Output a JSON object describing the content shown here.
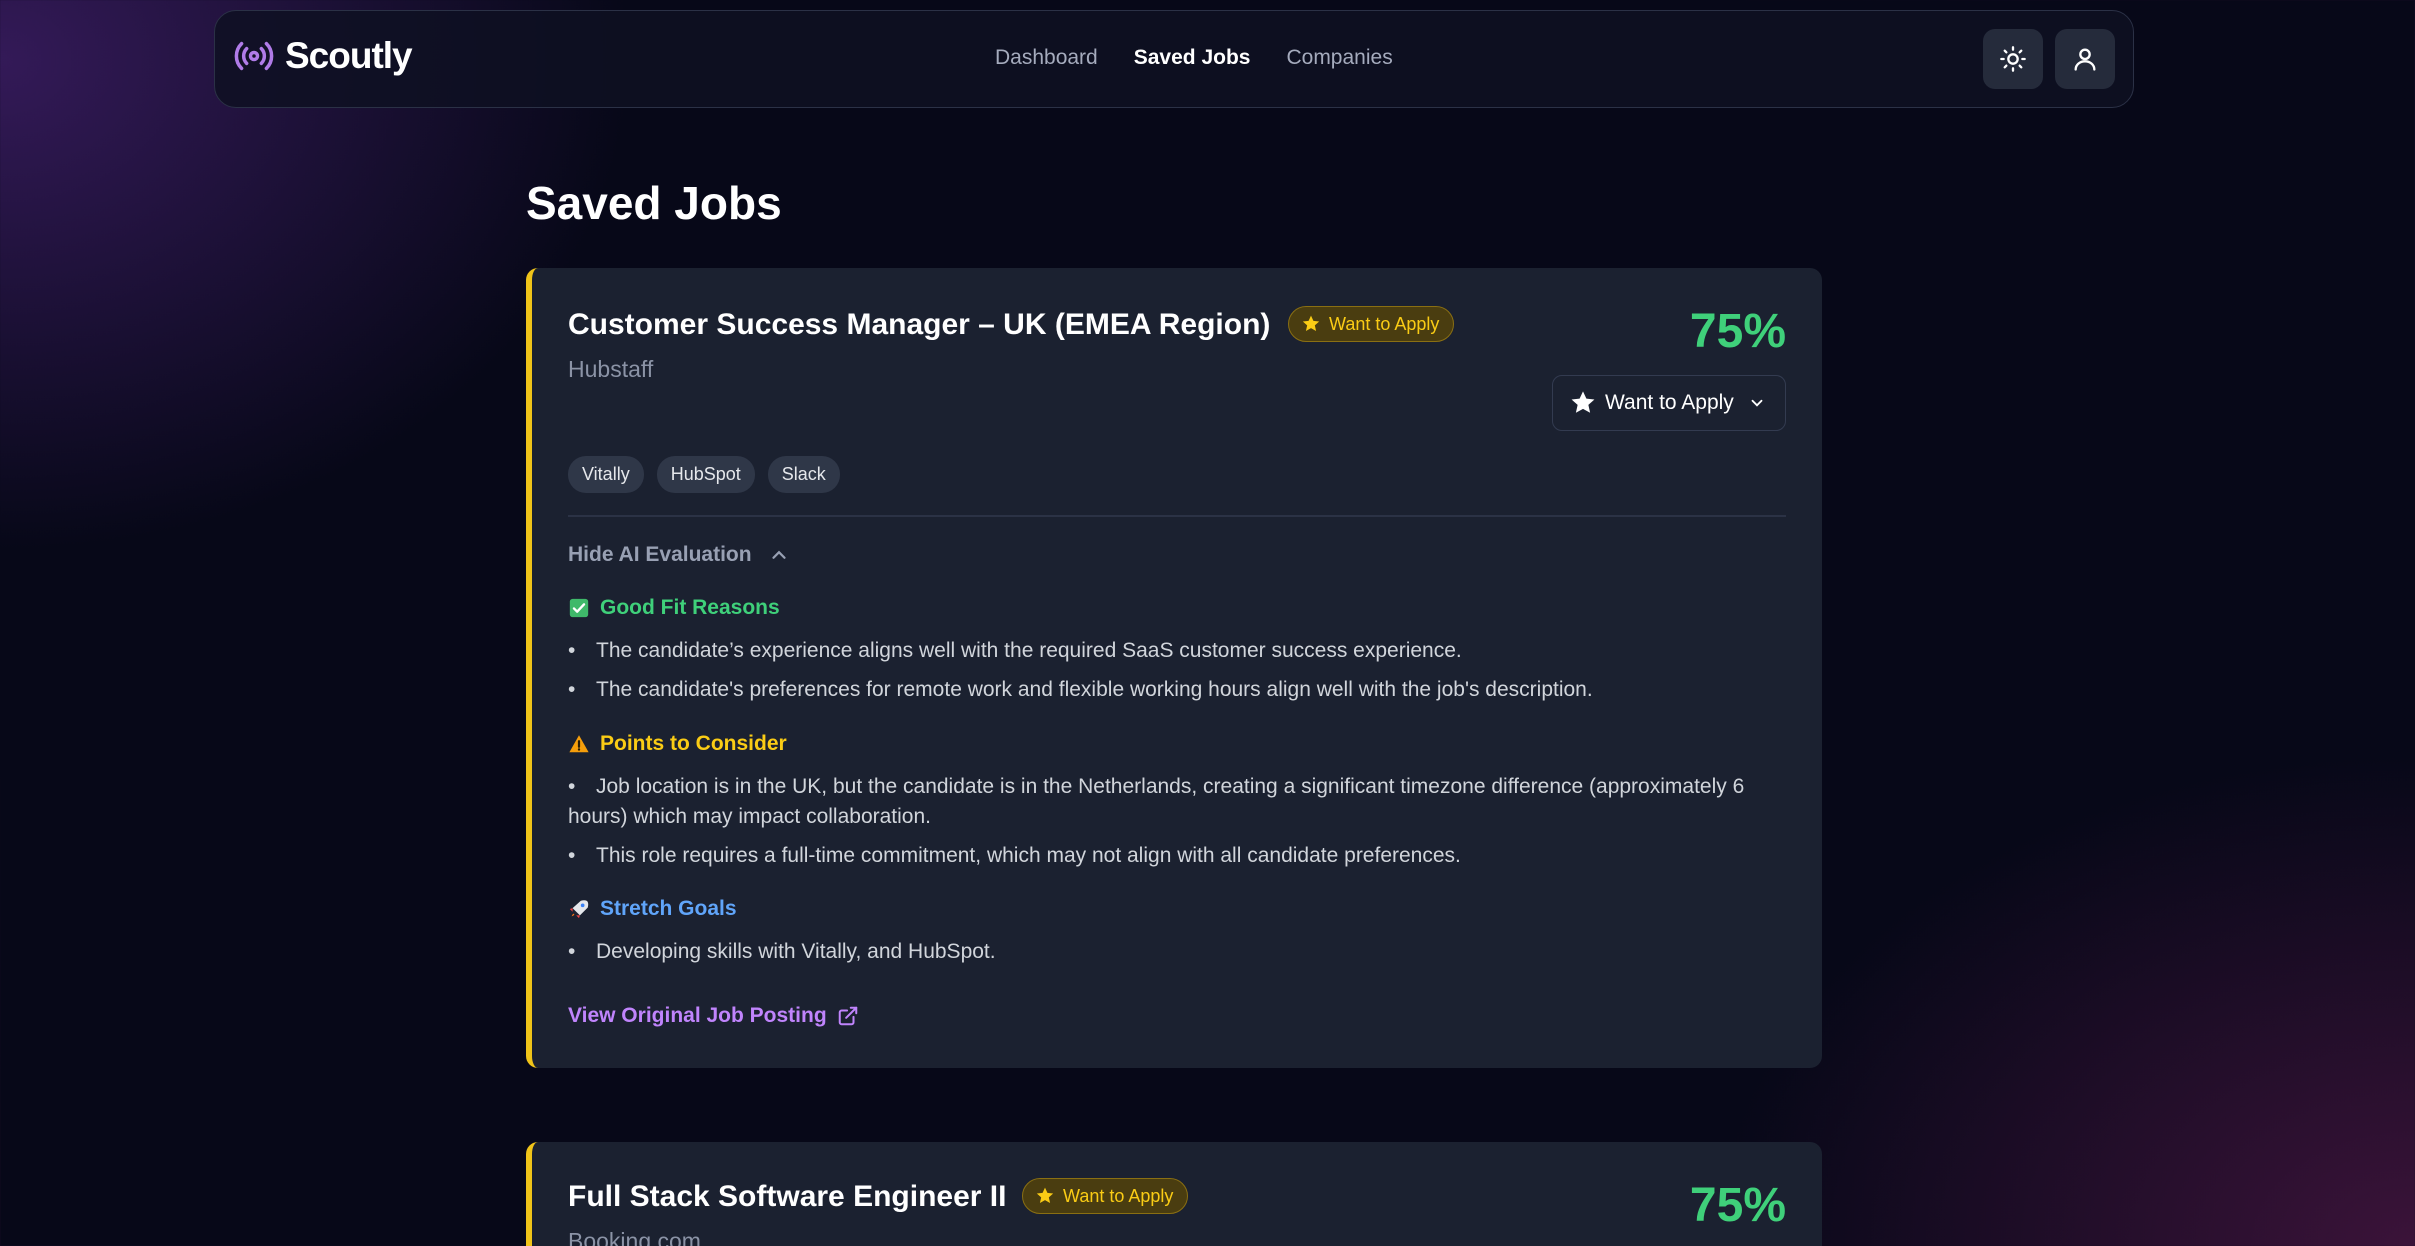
{
  "app": {
    "brand": "Scoutly",
    "nav": {
      "dashboard": "Dashboard",
      "saved_jobs": "Saved Jobs",
      "companies": "Companies"
    }
  },
  "page": {
    "title": "Saved Jobs"
  },
  "jobs": [
    {
      "title": "Customer Success Manager – UK (EMEA Region)",
      "badge": "Want to Apply",
      "company": "Hubstaff",
      "score": "75%",
      "status": "Want to Apply",
      "tags": [
        "Vitally",
        "HubSpot",
        "Slack"
      ],
      "ai_toggle": "Hide AI Evaluation",
      "good_fit": {
        "heading": "Good Fit Reasons",
        "items": [
          "The candidate’s experience aligns well with the required SaaS customer success experience.",
          "The candidate's preferences for remote work and flexible working hours align well with the job's description."
        ]
      },
      "consider": {
        "heading": "Points to Consider",
        "items": [
          "Job location is in the UK, but the candidate is in the Netherlands, creating a significant timezone difference (approximately 6 hours) which may impact collaboration.",
          "This role requires a full-time commitment, which may not align with all candidate preferences."
        ]
      },
      "stretch": {
        "heading": "Stretch Goals",
        "items": [
          "Developing skills with Vitally, and HubSpot."
        ]
      },
      "link": "View Original Job Posting"
    },
    {
      "title": "Full Stack Software Engineer II",
      "badge": "Want to Apply",
      "company": "Booking.com",
      "score": "75%"
    }
  ],
  "colors": {
    "accent_purple": "#c084fc",
    "score_green": "#3fd07a",
    "badge_yellow": "#facc15",
    "card_border": "#f0c419"
  }
}
